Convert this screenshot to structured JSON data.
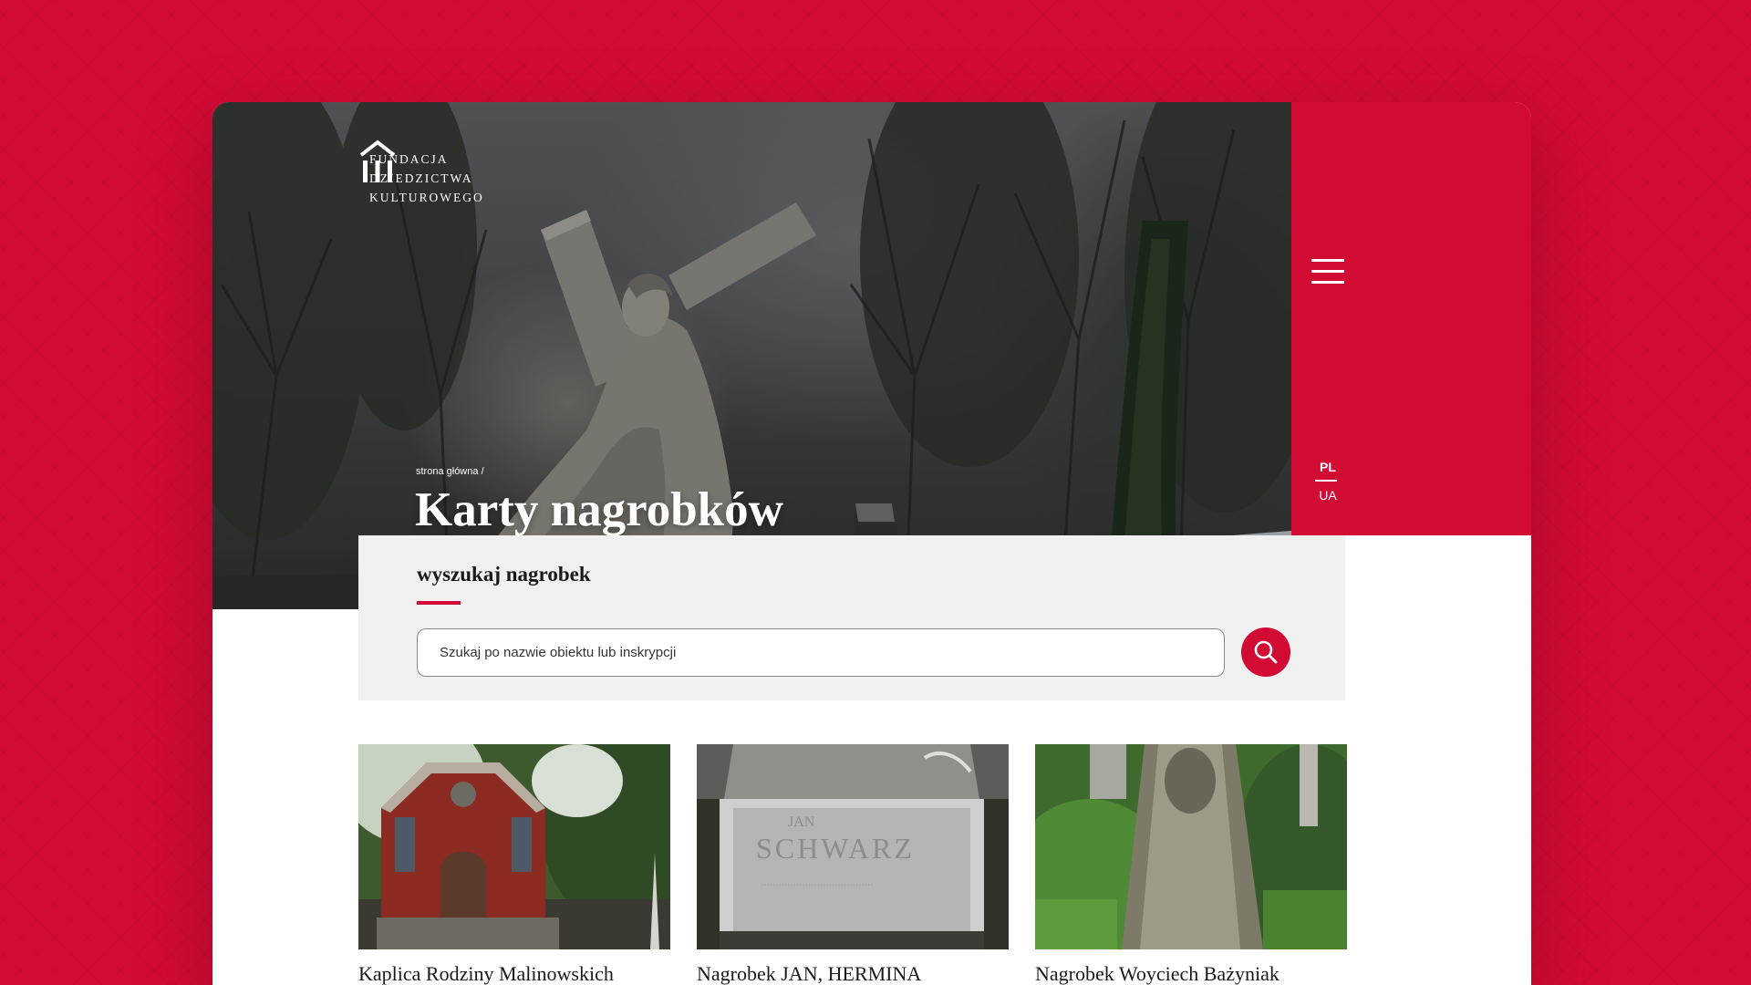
{
  "logo": {
    "lines": [
      "FUNDACJA",
      "DZIEDZICTWA",
      "KULTUROWEGO"
    ],
    "icon": "foundation-building-icon"
  },
  "header": {
    "menu_icon": "hamburger-menu-icon"
  },
  "languages": {
    "items": [
      "PL",
      "UA"
    ],
    "active": "PL"
  },
  "breadcrumb": {
    "home": "strona główna",
    "separator": "/"
  },
  "hero": {
    "title": "Karty nagrobków"
  },
  "search": {
    "heading": "wyszukaj nagrobek",
    "placeholder": "Szukaj po nazwie obiektu lub inskrypcji",
    "value": "",
    "button_icon": "search-icon"
  },
  "cards": [
    {
      "title": "Kaplica Rodziny Malinowskich"
    },
    {
      "title": "Nagrobek JAN, HERMINA"
    },
    {
      "title": "Nagrobek Woyciech Bażyniak"
    }
  ],
  "colors": {
    "brand": "#d20b35",
    "panel": "#f0f0f0",
    "text": "#1a1a1a"
  }
}
